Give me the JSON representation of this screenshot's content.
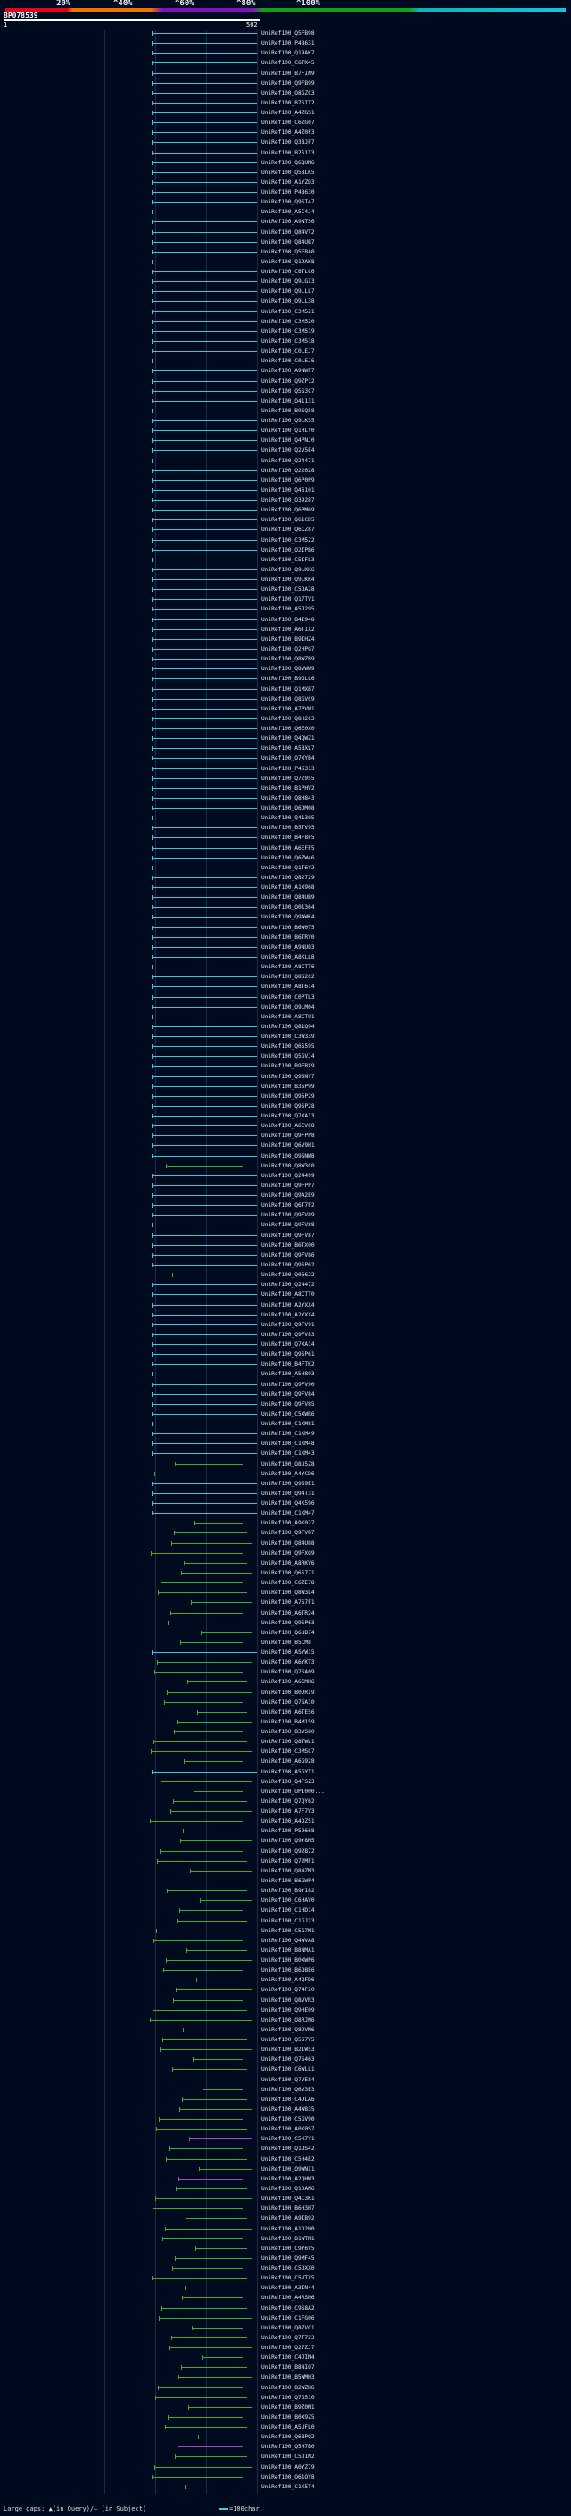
{
  "header": {
    "percent_labels": [
      "20%",
      "^40%",
      "^60%",
      "^80%",
      "^100%"
    ],
    "query_id": "BP078539",
    "scale_start": "1",
    "scale_end": "502"
  },
  "colors": {
    "cyan": "#3cc8dc",
    "green": "#3cae28",
    "magenta": "#b040c0",
    "gap": "#8c8c8c",
    "grid": "#1b2c4a"
  },
  "hits": [
    {
      "label": "UniRef100_Q5FB98",
      "color": "cyan"
    },
    {
      "label": "UniRef100_P48631",
      "color": "cyan"
    },
    {
      "label": "UniRef100_Q19AK7",
      "color": "cyan"
    },
    {
      "label": "UniRef100_C6TK45",
      "color": "cyan"
    },
    {
      "label": "UniRef100_B7FIN9",
      "color": "cyan"
    },
    {
      "label": "UniRef100_Q9FB99",
      "color": "cyan"
    },
    {
      "label": "UniRef100_Q8GZC3",
      "color": "cyan"
    },
    {
      "label": "UniRef100_B7SIT2",
      "color": "cyan"
    },
    {
      "label": "UniRef100_A4ZGS1",
      "color": "cyan"
    },
    {
      "label": "UniRef100_C6ZG07",
      "color": "cyan"
    },
    {
      "label": "UniRef100_A4Z0F3",
      "color": "cyan"
    },
    {
      "label": "UniRef100_Q38JF7",
      "color": "cyan"
    },
    {
      "label": "UniRef100_B7S1T3",
      "color": "cyan"
    },
    {
      "label": "UniRef100_Q6QUM6",
      "color": "cyan"
    },
    {
      "label": "UniRef100_Q5BLK5",
      "color": "cyan"
    },
    {
      "label": "UniRef100_A1YZD3",
      "color": "cyan"
    },
    {
      "label": "UniRef100_P48630",
      "color": "cyan"
    },
    {
      "label": "UniRef100_Q9ST47",
      "color": "cyan"
    },
    {
      "label": "UniRef100_A5C4J4",
      "color": "cyan"
    },
    {
      "label": "UniRef100_A9NT56",
      "color": "cyan"
    },
    {
      "label": "UniRef100_Q84VT2",
      "color": "cyan"
    },
    {
      "label": "UniRef100_Q84UB7",
      "color": "cyan"
    },
    {
      "label": "UniRef100_Q5FBA0",
      "color": "cyan"
    },
    {
      "label": "UniRef100_Q19AK8",
      "color": "cyan"
    },
    {
      "label": "UniRef100_C6TLC6",
      "color": "cyan"
    },
    {
      "label": "UniRef100_Q9LGI3",
      "color": "cyan"
    },
    {
      "label": "UniRef100_Q9LLL7",
      "color": "cyan"
    },
    {
      "label": "UniRef100_Q9LL38",
      "color": "cyan"
    },
    {
      "label": "UniRef100_C3M521",
      "color": "cyan"
    },
    {
      "label": "UniRef100_C3M520",
      "color": "cyan"
    },
    {
      "label": "UniRef100_C3M519",
      "color": "cyan"
    },
    {
      "label": "UniRef100_C3M518",
      "color": "cyan"
    },
    {
      "label": "UniRef100_C0LEJ7",
      "color": "cyan"
    },
    {
      "label": "UniRef100_C0LEJ6",
      "color": "cyan"
    },
    {
      "label": "UniRef100_A9NWF7",
      "color": "cyan"
    },
    {
      "label": "UniRef100_Q9ZP12",
      "color": "cyan"
    },
    {
      "label": "UniRef100_Q5S3C7",
      "color": "cyan"
    },
    {
      "label": "UniRef100_Q41131",
      "color": "cyan"
    },
    {
      "label": "UniRef100_B9SQ58",
      "color": "cyan"
    },
    {
      "label": "UniRef100_Q9LKS5",
      "color": "cyan"
    },
    {
      "label": "UniRef100_Q1HLY0",
      "color": "cyan"
    },
    {
      "label": "UniRef100_Q4PNJ0",
      "color": "cyan"
    },
    {
      "label": "UniRef100_Q2V5E4",
      "color": "cyan"
    },
    {
      "label": "UniRef100_Q24471",
      "color": "cyan"
    },
    {
      "label": "UniRef100_Q22628",
      "color": "cyan"
    },
    {
      "label": "UniRef100_Q6P0P9",
      "color": "cyan"
    },
    {
      "label": "UniRef100_Q46101",
      "color": "cyan"
    },
    {
      "label": "UniRef100_Q39287",
      "color": "cyan"
    },
    {
      "label": "UniRef100_Q6PM69",
      "color": "cyan"
    },
    {
      "label": "UniRef100_Q61CD5",
      "color": "cyan"
    },
    {
      "label": "UniRef100_Q6CZ87",
      "color": "cyan"
    },
    {
      "label": "UniRef100_C3M522",
      "color": "cyan"
    },
    {
      "label": "UniRef100_Q2IPB6",
      "color": "cyan"
    },
    {
      "label": "UniRef100_C5IFL3",
      "color": "cyan"
    },
    {
      "label": "UniRef100_Q9LKK6",
      "color": "cyan"
    },
    {
      "label": "UniRef100_Q9LKK4",
      "color": "cyan"
    },
    {
      "label": "UniRef100_C5DA28",
      "color": "cyan"
    },
    {
      "label": "UniRef100_Q17TV1",
      "color": "cyan"
    },
    {
      "label": "UniRef100_A5J295",
      "color": "cyan"
    },
    {
      "label": "UniRef100_B4I948",
      "color": "cyan"
    },
    {
      "label": "UniRef100_A6TIX2",
      "color": "cyan"
    },
    {
      "label": "UniRef100_B9IHZ4",
      "color": "cyan"
    },
    {
      "label": "UniRef100_Q2HPG7",
      "color": "cyan"
    },
    {
      "label": "UniRef100_Q8WZB9",
      "color": "cyan"
    },
    {
      "label": "UniRef100_Q8VWW9",
      "color": "cyan"
    },
    {
      "label": "UniRef100_B9GLL6",
      "color": "cyan"
    },
    {
      "label": "UniRef100_Q1MXB7",
      "color": "cyan"
    },
    {
      "label": "UniRef100_Q8GVC9",
      "color": "cyan"
    },
    {
      "label": "UniRef100_A7PVW1",
      "color": "cyan"
    },
    {
      "label": "UniRef100_Q8H2C3",
      "color": "cyan"
    },
    {
      "label": "UniRef100_Q6E0X0",
      "color": "cyan"
    },
    {
      "label": "UniRef100_Q4QWZ1",
      "color": "cyan"
    },
    {
      "label": "UniRef100_A5BXL7",
      "color": "cyan"
    },
    {
      "label": "UniRef100_Q7XYB4",
      "color": "cyan"
    },
    {
      "label": "UniRef100_P46313",
      "color": "cyan"
    },
    {
      "label": "UniRef100_Q7Z955",
      "color": "cyan"
    },
    {
      "label": "UniRef100_B1PHV2",
      "color": "cyan"
    },
    {
      "label": "UniRef100_Q8H843",
      "color": "cyan"
    },
    {
      "label": "UniRef100_Q6DM08",
      "color": "cyan"
    },
    {
      "label": "UniRef100_Q41305",
      "color": "cyan"
    },
    {
      "label": "UniRef100_B5TV95",
      "color": "cyan"
    },
    {
      "label": "UniRef100_B4F8F5",
      "color": "cyan"
    },
    {
      "label": "UniRef100_A6EFF5",
      "color": "cyan"
    },
    {
      "label": "UniRef100_Q6ZW46",
      "color": "cyan"
    },
    {
      "label": "UniRef100_Q1T6Y2",
      "color": "cyan"
    },
    {
      "label": "UniRef100_Q82729",
      "color": "cyan"
    },
    {
      "label": "UniRef100_A1X968",
      "color": "cyan"
    },
    {
      "label": "UniRef100_Q84UB9",
      "color": "cyan"
    },
    {
      "label": "UniRef100_Q01364",
      "color": "cyan"
    },
    {
      "label": "UniRef100_Q9AWK4",
      "color": "cyan"
    },
    {
      "label": "UniRef100_B6W0T5",
      "color": "cyan"
    },
    {
      "label": "UniRef100_B6TRY0",
      "color": "cyan"
    },
    {
      "label": "UniRef100_A9NUQ3",
      "color": "cyan"
    },
    {
      "label": "UniRef100_A8KLL8",
      "color": "cyan"
    },
    {
      "label": "UniRef100_A8CTT6",
      "color": "cyan"
    },
    {
      "label": "UniRef100_Q8S2C2",
      "color": "cyan"
    },
    {
      "label": "UniRef100_A8T614",
      "color": "cyan"
    },
    {
      "label": "UniRef100_C0PTL3",
      "color": "cyan"
    },
    {
      "label": "UniRef100_Q9LM04",
      "color": "cyan"
    },
    {
      "label": "UniRef100_A8CTU1",
      "color": "cyan"
    },
    {
      "label": "UniRef100_Q81Q94",
      "color": "cyan"
    },
    {
      "label": "UniRef100_C3W339",
      "color": "cyan"
    },
    {
      "label": "UniRef100_Q6S595",
      "color": "cyan"
    },
    {
      "label": "UniRef100_Q5GVJ4",
      "color": "cyan"
    },
    {
      "label": "UniRef100_B9FBX9",
      "color": "cyan"
    },
    {
      "label": "UniRef100_Q9SNY7",
      "color": "cyan"
    },
    {
      "label": "UniRef100_B3SP99",
      "color": "cyan"
    },
    {
      "label": "UniRef100_Q95P29",
      "color": "cyan"
    },
    {
      "label": "UniRef100_Q9SP28",
      "color": "cyan"
    },
    {
      "label": "UniRef100_Q7XA13",
      "color": "cyan"
    },
    {
      "label": "UniRef100_A6CVC8",
      "color": "cyan"
    },
    {
      "label": "UniRef100_Q9FPP8",
      "color": "cyan"
    },
    {
      "label": "UniRef100_Q6V9H1",
      "color": "cyan"
    },
    {
      "label": "UniRef100_Q9SNW8",
      "color": "cyan"
    },
    {
      "label": "UniRef100_Q8W3C0",
      "color": "green"
    },
    {
      "label": "UniRef100_Q24499",
      "color": "cyan"
    },
    {
      "label": "UniRef100_Q9FPP7",
      "color": "cyan"
    },
    {
      "label": "UniRef100_Q9A2E9",
      "color": "cyan"
    },
    {
      "label": "UniRef100_Q6T7F2",
      "color": "cyan"
    },
    {
      "label": "UniRef100_Q9FV89",
      "color": "cyan"
    },
    {
      "label": "UniRef100_Q9FV88",
      "color": "cyan"
    },
    {
      "label": "UniRef100_Q9FV87",
      "color": "cyan"
    },
    {
      "label": "UniRef100_B6TX00",
      "color": "cyan"
    },
    {
      "label": "UniRef100_Q9FV86",
      "color": "cyan"
    },
    {
      "label": "UniRef100_Q9SP62",
      "color": "cyan"
    },
    {
      "label": "UniRef100_Q06622",
      "color": "green"
    },
    {
      "label": "UniRef100_Q24472",
      "color": "cyan"
    },
    {
      "label": "UniRef100_A8CTT0",
      "color": "cyan"
    },
    {
      "label": "UniRef100_A2YXX4",
      "color": "cyan"
    },
    {
      "label": "UniRef100_A2YXX4",
      "color": "cyan"
    },
    {
      "label": "UniRef100_Q9FV91",
      "color": "cyan"
    },
    {
      "label": "UniRef100_Q9FV83",
      "color": "cyan"
    },
    {
      "label": "UniRef100_Q7XA14",
      "color": "cyan"
    },
    {
      "label": "UniRef100_Q9SP61",
      "color": "cyan"
    },
    {
      "label": "UniRef100_B4FTK2",
      "color": "cyan"
    },
    {
      "label": "UniRef100_A5H893",
      "color": "cyan"
    },
    {
      "label": "UniRef100_Q9FV90",
      "color": "cyan"
    },
    {
      "label": "UniRef100_Q9FV84",
      "color": "cyan"
    },
    {
      "label": "UniRef100_Q9FV85",
      "color": "cyan"
    },
    {
      "label": "UniRef100_C5XWR6",
      "color": "cyan"
    },
    {
      "label": "UniRef100_C1KM81",
      "color": "cyan"
    },
    {
      "label": "UniRef100_C1KM49",
      "color": "cyan"
    },
    {
      "label": "UniRef100_C1KM48",
      "color": "cyan"
    },
    {
      "label": "UniRef100_C1KM43",
      "color": "cyan"
    },
    {
      "label": "UniRef100_Q8U5Z8",
      "color": "green"
    },
    {
      "label": "UniRef100_A4YCD6",
      "color": "green"
    },
    {
      "label": "UniRef100_Q9S9E1",
      "color": "cyan"
    },
    {
      "label": "UniRef100_Q94T31",
      "color": "cyan"
    },
    {
      "label": "UniRef100_Q4K596",
      "color": "cyan"
    },
    {
      "label": "UniRef100_C1KM47",
      "color": "cyan"
    },
    {
      "label": "UniRef100_A9K027",
      "color": "green"
    },
    {
      "label": "UniRef100_Q9FV87",
      "color": "green"
    },
    {
      "label": "UniRef100_Q84U88",
      "color": "green"
    },
    {
      "label": "UniRef100_Q9FXG9",
      "color": "green"
    },
    {
      "label": "UniRef100_A8RKV6",
      "color": "green"
    },
    {
      "label": "UniRef100_Q6S771",
      "color": "green"
    },
    {
      "label": "UniRef100_C6ZE78",
      "color": "green"
    },
    {
      "label": "UniRef100_Q8W3L4",
      "color": "green"
    },
    {
      "label": "UniRef100_A7S7F1",
      "color": "green"
    },
    {
      "label": "UniRef100_A6TR24",
      "color": "green"
    },
    {
      "label": "UniRef100_Q9SP63",
      "color": "green"
    },
    {
      "label": "UniRef100_Q6UB74",
      "color": "green"
    },
    {
      "label": "UniRef100_B5CM8",
      "color": "green"
    },
    {
      "label": "UniRef100_A5YW15",
      "color": "cyan"
    },
    {
      "label": "UniRef100_A6YKT3",
      "color": "green"
    },
    {
      "label": "UniRef100_Q7SA09",
      "color": "green"
    },
    {
      "label": "UniRef100_A6CMH6",
      "color": "green"
    },
    {
      "label": "UniRef100_B0JRI9",
      "color": "green"
    },
    {
      "label": "UniRef100_Q7SA10",
      "color": "green"
    },
    {
      "label": "UniRef100_A6TE56",
      "color": "green"
    },
    {
      "label": "UniRef100_B4M159",
      "color": "green"
    },
    {
      "label": "UniRef100_B3VS80",
      "color": "green"
    },
    {
      "label": "UniRef100_Q8TWL1",
      "color": "green"
    },
    {
      "label": "UniRef100_C3MSC7",
      "color": "green"
    },
    {
      "label": "UniRef100_A6G928",
      "color": "green"
    },
    {
      "label": "UniRef100_A5GYT1",
      "color": "cyan"
    },
    {
      "label": "UniRef100_Q4FSZ3",
      "color": "green"
    },
    {
      "label": "UniRef100_UPI000...",
      "color": "green"
    },
    {
      "label": "UniRef100_Q7QY62",
      "color": "green"
    },
    {
      "label": "UniRef100_A7F7V3",
      "color": "green"
    },
    {
      "label": "UniRef100_A4DZ51",
      "color": "green"
    },
    {
      "label": "UniRef100_P59668",
      "color": "green"
    },
    {
      "label": "UniRef100_Q9Y8M5",
      "color": "green"
    },
    {
      "label": "UniRef100_Q92B72",
      "color": "green"
    },
    {
      "label": "UniRef100_Q72MF1",
      "color": "green"
    },
    {
      "label": "UniRef100_Q8NZM3",
      "color": "green"
    },
    {
      "label": "UniRef100_B6GWP4",
      "color": "green"
    },
    {
      "label": "UniRef100_B9Y182",
      "color": "green"
    },
    {
      "label": "UniRef100_C6HAV0",
      "color": "green"
    },
    {
      "label": "UniRef100_C1HD14",
      "color": "green"
    },
    {
      "label": "UniRef100_C1GJ23",
      "color": "green"
    },
    {
      "label": "UniRef100_C5G7M1",
      "color": "green"
    },
    {
      "label": "UniRef100_Q4WVA8",
      "color": "green"
    },
    {
      "label": "UniRef100_B8NMA1",
      "color": "green"
    },
    {
      "label": "UniRef100_B0XWP6",
      "color": "green"
    },
    {
      "label": "UniRef100_B6Q8E6",
      "color": "green"
    },
    {
      "label": "UniRef100_A4QFD6",
      "color": "green"
    },
    {
      "label": "UniRef100_Q74F20",
      "color": "green"
    },
    {
      "label": "UniRef100_Q8VVR3",
      "color": "green"
    },
    {
      "label": "UniRef100_Q9HE09",
      "color": "green"
    },
    {
      "label": "UniRef100_Q8RJN6",
      "color": "green"
    },
    {
      "label": "UniRef100_Q8DVN6",
      "color": "green"
    },
    {
      "label": "UniRef100_Q5S7V5",
      "color": "green"
    },
    {
      "label": "UniRef100_B2IW53",
      "color": "green"
    },
    {
      "label": "UniRef100_Q7S463",
      "color": "green"
    },
    {
      "label": "UniRef100_C6WLL1",
      "color": "green"
    },
    {
      "label": "UniRef100_Q7VE84",
      "color": "green"
    },
    {
      "label": "UniRef100_Q6V3E3",
      "color": "green"
    },
    {
      "label": "UniRef100_C4JLA6",
      "color": "green"
    },
    {
      "label": "UniRef100_A4W835",
      "color": "green"
    },
    {
      "label": "UniRef100_C5GV90",
      "color": "green"
    },
    {
      "label": "UniRef100_A0K0S7",
      "color": "green"
    },
    {
      "label": "UniRef100_C5K7Y1",
      "color": "magenta"
    },
    {
      "label": "UniRef100_Q1DS42",
      "color": "green"
    },
    {
      "label": "UniRef100_C5H4E2",
      "color": "green"
    },
    {
      "label": "UniRef100_Q9WNI1",
      "color": "green"
    },
    {
      "label": "UniRef100_A2QHW3",
      "color": "magenta"
    },
    {
      "label": "UniRef100_Q10AN6",
      "color": "green"
    },
    {
      "label": "UniRef100_Q4C3K1",
      "color": "green"
    },
    {
      "label": "UniRef100_B6H3H7",
      "color": "green"
    },
    {
      "label": "UniRef100_A9IB92",
      "color": "green"
    },
    {
      "label": "UniRef100_A1D2H0",
      "color": "green"
    },
    {
      "label": "UniRef100_B1WTM1",
      "color": "green"
    },
    {
      "label": "UniRef100_C9Y6V5",
      "color": "green"
    },
    {
      "label": "UniRef100_Q9MF45",
      "color": "green"
    },
    {
      "label": "UniRef100_C5DXX0",
      "color": "green"
    },
    {
      "label": "UniRef100_C5VTX5",
      "color": "green"
    },
    {
      "label": "UniRef100_A3IN44",
      "color": "green"
    },
    {
      "label": "UniRef100_A4RSN6",
      "color": "green"
    },
    {
      "label": "UniRef100_C9S8A2",
      "color": "green"
    },
    {
      "label": "UniRef100_C1FG06",
      "color": "green"
    },
    {
      "label": "UniRef100_Q87VC1",
      "color": "green"
    },
    {
      "label": "UniRef100_Q7T723",
      "color": "green"
    },
    {
      "label": "UniRef100_Q27ZJ7",
      "color": "green"
    },
    {
      "label": "UniRef100_C4JIM4",
      "color": "green"
    },
    {
      "label": "UniRef100_B8NIO7",
      "color": "green"
    },
    {
      "label": "UniRef100_B5WMH3",
      "color": "green"
    },
    {
      "label": "UniRef100_B2WZH6",
      "color": "green"
    },
    {
      "label": "UniRef100_Q7G510",
      "color": "green"
    },
    {
      "label": "UniRef100_B9Z0M1",
      "color": "green"
    },
    {
      "label": "UniRef100_B0X9Z5",
      "color": "green"
    },
    {
      "label": "UniRef100_A5UFL0",
      "color": "green"
    },
    {
      "label": "UniRef100_Q6BPQ2",
      "color": "green"
    },
    {
      "label": "UniRef100_Q5H7B0",
      "color": "magenta"
    },
    {
      "label": "UniRef100_C5D1N2",
      "color": "green"
    },
    {
      "label": "UniRef100_A0YZ79",
      "color": "green"
    },
    {
      "label": "UniRef100_Q61QY8",
      "color": "green"
    },
    {
      "label": "UniRef100_C1K5T4",
      "color": "green"
    }
  ],
  "legend": {
    "text": "Large gaps: ▲(in Query)/– (in Subject)",
    "scale_text": "=100char."
  }
}
